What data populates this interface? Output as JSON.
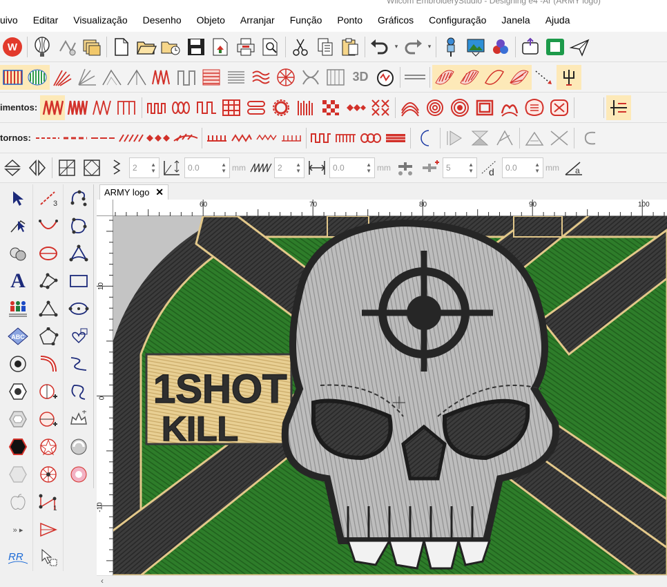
{
  "window": {
    "title_fragment": "Wilcom EmbroideryStudio - Designing e4 -Ar (ARMY logo)"
  },
  "menu": [
    "uivo",
    "Editar",
    "Visualização",
    "Desenho",
    "Objeto",
    "Arranjar",
    "Função",
    "Ponto",
    "Gráficos",
    "Configuração",
    "Janela",
    "Ajuda"
  ],
  "toolbars": {
    "fill_label": "imentos:",
    "outline_label": "tornos:"
  },
  "properties": {
    "stitch_count": "2",
    "spacing_a": "0.0",
    "unit_a": "mm",
    "spacing_count": "2",
    "spacing_b": "0.0",
    "unit_b": "mm",
    "density": "5",
    "offset": "0.0",
    "unit_c": "mm"
  },
  "document_tab": {
    "label": "ARMY logo",
    "close": "✕"
  },
  "ruler": {
    "h_ticks": [
      "60",
      "70",
      "80",
      "90",
      "100"
    ],
    "v_ticks": [
      "10",
      "0",
      "-10"
    ]
  },
  "patch": {
    "text_line1": "1SHOT",
    "text_line2": "KILL"
  },
  "colors": {
    "accent_red": "#d2312a",
    "embroidery_green": "#2e7d2a",
    "thread_dark": "#3a3a3a",
    "thread_gold": "#e3c88a",
    "thread_silver": "#b9b9b9",
    "highlight": "#fde9b8"
  },
  "left_tools": [
    "select-arrow-icon",
    "reshape-icon",
    "stitch-player-icon",
    "lettering-icon",
    "team-names-icon",
    "monogram-icon",
    "circle-icon",
    "hexagon-icon",
    "shape-icon",
    "black-hexagon-icon",
    "white-hexagon-icon",
    "apple-icon",
    "more-icon",
    "rr-logo-icon"
  ]
}
